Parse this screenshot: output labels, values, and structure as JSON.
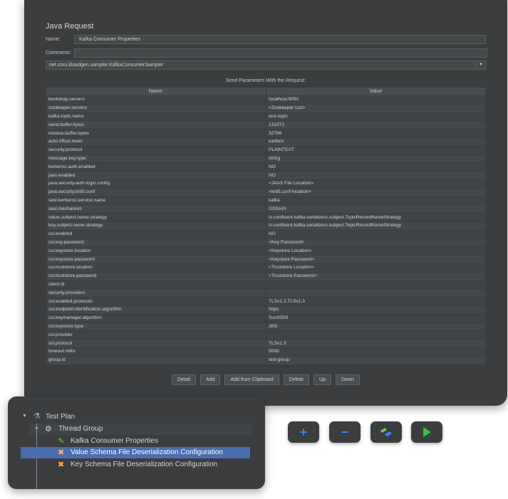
{
  "colors": {
    "panel": "#3b3d3f",
    "selection": "#4b6eaf",
    "accent_blue": "#3a86ff",
    "start_green": "#36c23a"
  },
  "request": {
    "title": "Java Request",
    "name_label": "Name:",
    "name_value": "Kafka Consumer Properties",
    "comments_label": "Comments:",
    "comments_value": "",
    "classname": "net.coru.kloadgen.sampler.KafkaConsumerSampler",
    "caption": "Send Parameters With the Request:",
    "col_name": "Name:",
    "col_value": "Value",
    "params": [
      [
        "bootstrap.servers",
        "localhost:9092"
      ],
      [
        "zookeeper.servers",
        "<Zookeeper List>"
      ],
      [
        "kafka.topic.name",
        "test-topic"
      ],
      [
        "send.buffer.bytes",
        "131072"
      ],
      [
        "receive.buffer.bytes",
        "32768"
      ],
      [
        "auto.offset.reset",
        "earliest"
      ],
      [
        "security.protocol",
        "PLAINTEXT"
      ],
      [
        "message.key.type",
        "string"
      ],
      [
        "kerberos.auth.enabled",
        "NO"
      ],
      [
        "jaas.enabled",
        "NO"
      ],
      [
        "java.security.auth.login.config",
        "<JAAS File Location>"
      ],
      [
        "java.security.krb5.conf",
        "<krb5.conf location>"
      ],
      [
        "sasl.kerberos.service.name",
        "kafka"
      ],
      [
        "sasl.mechanism",
        "GSSAPI"
      ],
      [
        "value.subject.name.strategy",
        "io.confluent.kafka.serializers.subject.TopicRecordNameStrategy"
      ],
      [
        "key.subject.name.strategy",
        "io.confluent.kafka.serializers.subject.TopicRecordNameStrategy"
      ],
      [
        "ssl.enabled",
        "NO"
      ],
      [
        "ssl.key.password",
        "<Key Password>"
      ],
      [
        "ssl.keystore.location",
        "<Keystore Location>"
      ],
      [
        "ssl.keystore.password",
        "<Keystore Password>"
      ],
      [
        "ssl.truststore.location",
        "<Truststore Location>"
      ],
      [
        "ssl.truststore.password",
        "<Truststore Password>"
      ],
      [
        "client.id",
        ""
      ],
      [
        "security.providers",
        ""
      ],
      [
        "ssl.enabled.protocols",
        "TLSv1.2,TLSv1.3"
      ],
      [
        "ssl.endpoint.identification.algorithm",
        "https"
      ],
      [
        "ssl.keymanager.algorithm",
        "SunX509"
      ],
      [
        "ssl.keystore.type",
        "JKS"
      ],
      [
        "ssl.provider",
        ""
      ],
      [
        "ssl.protocol",
        "TLSv1.3"
      ],
      [
        "timeout.millis",
        "5000"
      ],
      [
        "group.id",
        "test-group"
      ]
    ],
    "buttons": [
      "Detail",
      "Add",
      "Add from Clipboard",
      "Delete",
      "Up",
      "Down"
    ]
  },
  "tree": {
    "test_plan": "Test Plan",
    "thread_group": "Thread Group",
    "items": [
      {
        "label": "Kafka Consumer Properties",
        "icon": "pencil-icon",
        "selected": false
      },
      {
        "label": "Value Schema File Deserialization Configuration",
        "icon": "tools-icon",
        "selected": true
      },
      {
        "label": "Key Schema File Deserialization Configuration",
        "icon": "tools-icon",
        "selected": false
      }
    ]
  },
  "toolbar": {
    "add": "+",
    "remove": "−",
    "toggle": "toggle-icon",
    "start": "start-icon"
  }
}
